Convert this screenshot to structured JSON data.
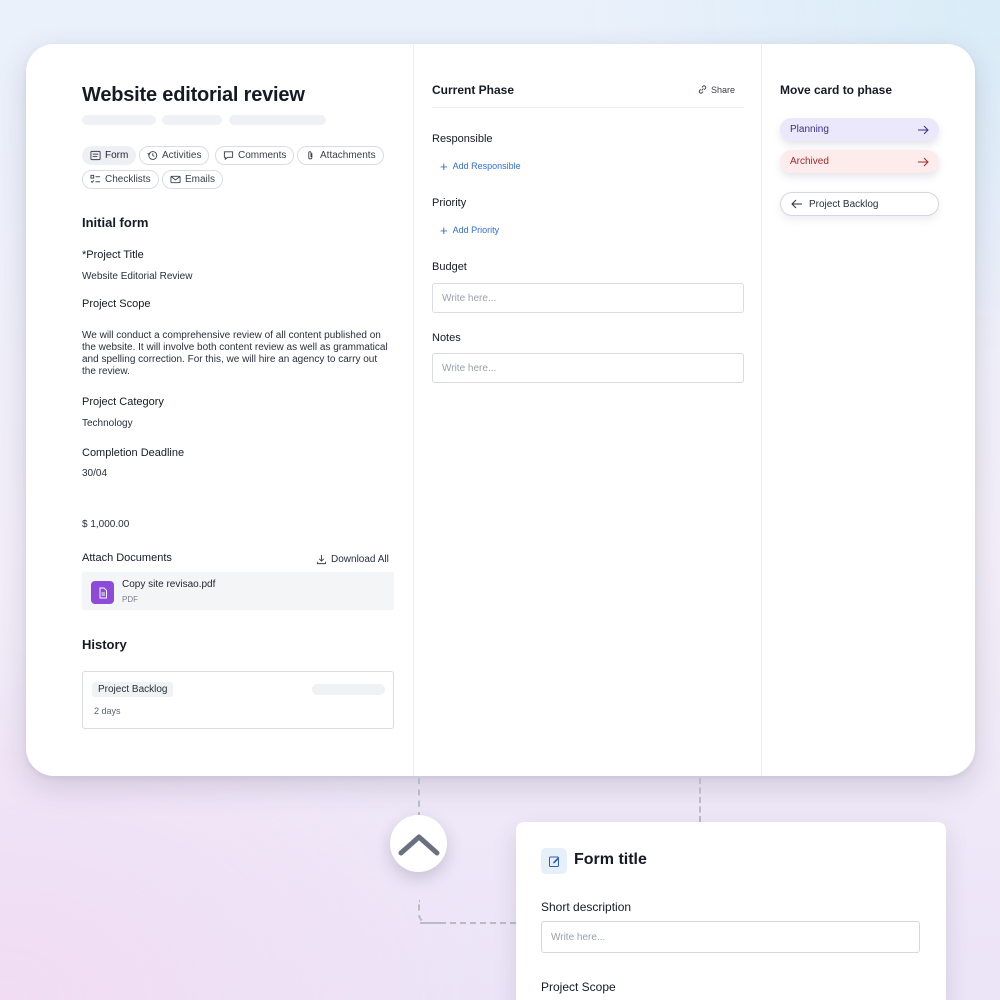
{
  "card": {
    "title": "Website editorial review",
    "tabs": [
      {
        "label": "Form",
        "icon": "form-icon"
      },
      {
        "label": "Activities",
        "icon": "history-icon"
      },
      {
        "label": "Comments",
        "icon": "comment-icon"
      },
      {
        "label": "Attachments",
        "icon": "paperclip-icon"
      },
      {
        "label": "Checklists",
        "icon": "checklist-icon"
      },
      {
        "label": "Emails",
        "icon": "mail-icon"
      }
    ],
    "section_title": "Initial form",
    "fields": {
      "project_title_label": "*Project Title",
      "project_title_value": "Website Editorial Review",
      "project_scope_label": "Project Scope",
      "project_scope_value": "We will conduct a comprehensive review of all content published on the website. It will involve both content review as well as grammatical and spelling correction. For this, we will hire an agency to carry out the review.",
      "category_label": "Project Category",
      "category_value": "Technology",
      "deadline_label": "Completion Deadline",
      "deadline_value": "30/04",
      "budget_value": "$ 1,000.00"
    },
    "attachments": {
      "label": "Attach Documents",
      "download_all": "Download All",
      "file_name": "Copy site revisao.pdf",
      "file_type": "PDF"
    },
    "history": {
      "title": "History",
      "tag": "Project Backlog",
      "time": "2 days"
    }
  },
  "phase": {
    "title": "Current Phase",
    "share": "Share",
    "responsible_label": "Responsible",
    "add_responsible": "Add Responsible",
    "priority_label": "Priority",
    "add_priority": "Add Priority",
    "budget_label": "Budget",
    "budget_placeholder": "Write here...",
    "notes_label": "Notes",
    "notes_placeholder": "Write here..."
  },
  "move": {
    "title": "Move card to phase",
    "planning": "Planning",
    "archived": "Archived",
    "back": "Project Backlog"
  },
  "form_card": {
    "title": "Form title",
    "short_desc_label": "Short description",
    "short_desc_placeholder": "Write here...",
    "scope_label": "Project Scope"
  },
  "colors": {
    "accent_blue": "#2f6fd6",
    "planning_bg": "#ece8fb",
    "archived_bg": "#fdeceb",
    "file_icon": "#8e4ad8"
  }
}
